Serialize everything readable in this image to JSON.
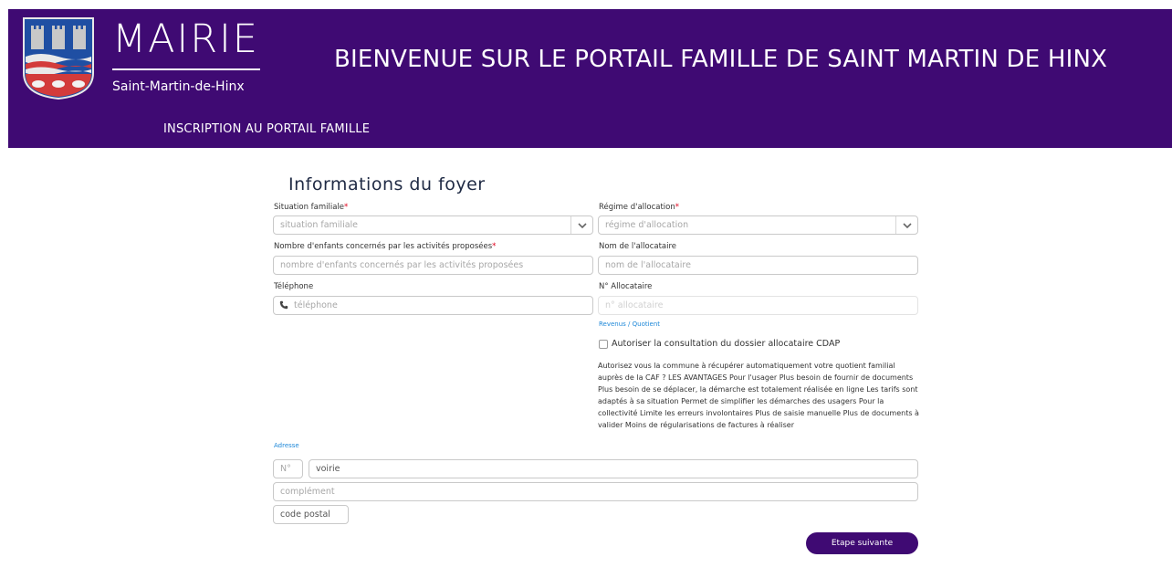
{
  "header": {
    "brand_title": "MAIRIE",
    "brand_subtitle": "Saint-Martin-de-Hinx",
    "welcome": "BIENVENUE SUR LE PORTAIL FAMILLE DE SAINT MARTIN DE HINX",
    "subnav": "INSCRIPTION AU PORTAIL FAMILLE",
    "background_color": "#3f0a73"
  },
  "form": {
    "section_title": "Informations du foyer",
    "situation": {
      "label": "Situation familiale",
      "required_mark": "*",
      "placeholder": "situation familiale",
      "icon": "chevron-down-icon"
    },
    "regime": {
      "label": "Régime d'allocation",
      "required_mark": "*",
      "placeholder": "régime d'allocation",
      "icon": "chevron-down-icon"
    },
    "enfants": {
      "label": "Nombre d'enfants concernés par les activités proposées",
      "required_mark": "*",
      "placeholder": "nombre d'enfants concernés par les activités proposées"
    },
    "allocataire_nom": {
      "label": "Nom de l'allocataire",
      "placeholder": "nom de l'allocataire"
    },
    "telephone": {
      "label": "Téléphone",
      "placeholder": "téléphone",
      "icon": "phone-icon"
    },
    "allocataire_num": {
      "label": "N° Allocataire",
      "placeholder": "n° allocataire"
    },
    "revenus_link": "Revenus / Quotient",
    "cdap_checkbox": {
      "label": "Autoriser la consultation du dossier allocataire CDAP",
      "checked": false
    },
    "caf_info": "Autorisez vous la commune à récupérer automatiquement votre quotient familial auprès de la CAF ? LES AVANTAGES Pour l'usager Plus besoin de fournir de documents Plus besoin de se déplacer, la démarche est totalement réalisée en ligne Les tarifs sont adaptés à sa situation Permet de simplifier les démarches des usagers Pour la collectivité Limite les erreurs involontaires Plus de saisie manuelle Plus de documents à valider Moins de régularisations de factures à réaliser",
    "adresse_link": "Adresse",
    "adresse": {
      "numero_placeholder": "N°",
      "voirie_placeholder": "voirie",
      "complement_placeholder": "complément",
      "code_postal_placeholder": "code postal"
    },
    "next_button": "Etape suivante"
  },
  "colors": {
    "primary": "#3f0a73",
    "required": "#e0001b",
    "link": "#1e88d8"
  }
}
